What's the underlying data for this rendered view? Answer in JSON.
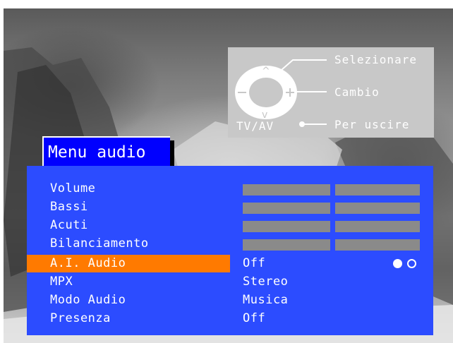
{
  "legend": {
    "select_label": "Selezionare",
    "change_label": "Cambio",
    "exit_label": "Per uscire",
    "tv_av_label": "TV/AV"
  },
  "menu": {
    "title": "Menu audio",
    "items": [
      {
        "label": "Volume",
        "type": "bar"
      },
      {
        "label": "Bassi",
        "type": "bar"
      },
      {
        "label": "Acuti",
        "type": "bar"
      },
      {
        "label": "Bilanciamento",
        "type": "bar"
      },
      {
        "label": "A.I. Audio",
        "type": "toggle",
        "value": "Off",
        "selected": true
      },
      {
        "label": "MPX",
        "type": "text",
        "value": "Stereo"
      },
      {
        "label": "Modo Audio",
        "type": "text",
        "value": "Musica"
      },
      {
        "label": "Presenza",
        "type": "text",
        "value": "Off"
      }
    ]
  },
  "colors": {
    "panel": "#2c4cff",
    "title_bg": "#0000ff",
    "selection": "#ff7a00",
    "bar": "#8a8a8a",
    "legend_bg": "#c8c8c8"
  }
}
